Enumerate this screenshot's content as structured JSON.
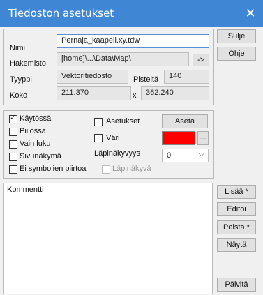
{
  "window": {
    "title": "Tiedoston asetukset",
    "close_glyph": "✕"
  },
  "file": {
    "name_label": "Nimi",
    "name_value": "Pernaja_kaapeli.xy.tdw",
    "dir_label": "Hakemisto",
    "dir_value": "[home]\\...\\Data\\Map\\",
    "dir_button": "->",
    "type_label": "Tyyppi",
    "type_value": "Vektoritiedosto",
    "points_label": "Pisteitä",
    "points_value": "140",
    "size_label": "Koko",
    "size_value": "211.370",
    "x_label": "x",
    "x_value": "362.240"
  },
  "options": {
    "enabled_label": "Käytössä",
    "enabled_checked": true,
    "hidden_label": "Piilossa",
    "readonly_label": "Vain luku",
    "sideview_label": "Sivunäkymä",
    "nosymbols_label": "Ei symbolien piirtoa",
    "settings_label": "Asetukset",
    "set_button": "Aseta",
    "color_label": "Väri",
    "color_value": "#ff0000",
    "color_button": "...",
    "transparency_label": "Läpinäkyvyys",
    "transparency_value": "0",
    "transparent_label": "Läpinäkyvä"
  },
  "comment": {
    "label": "Kommentti"
  },
  "buttons": {
    "close": "Sulje",
    "help": "Ohje",
    "add": "Lisää *",
    "edit": "Editoi",
    "remove": "Poista *",
    "show": "Näytä",
    "refresh": "Päivitä"
  }
}
